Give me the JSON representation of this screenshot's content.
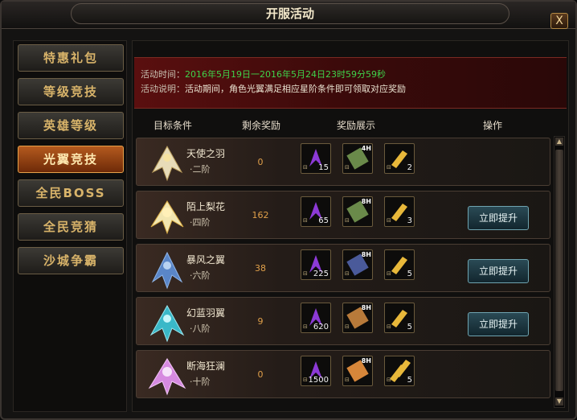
{
  "window": {
    "title": "开服活动",
    "close_label": "X"
  },
  "sidebar": {
    "items": [
      {
        "label": "特惠礼包",
        "active": false
      },
      {
        "label": "等级竞技",
        "active": false
      },
      {
        "label": "英雄等级",
        "active": false
      },
      {
        "label": "光翼竞技",
        "active": true
      },
      {
        "label": "全民BOSS",
        "active": false
      },
      {
        "label": "全民竞猜",
        "active": false
      },
      {
        "label": "沙城争霸",
        "active": false
      }
    ]
  },
  "banner": {
    "time_label": "活动时间：",
    "time_value": "2016年5月19日一2016年5月24日23时59分59秒",
    "desc_label": "活动说明：",
    "desc_value": "活动期间，角色光翼满足相应星阶条件即可领取对应奖励"
  },
  "headers": {
    "goal": "目标条件",
    "remaining": "剩余奖励",
    "rewards": "奖励展示",
    "action": "操作"
  },
  "rows": [
    {
      "name": "天使之羽",
      "tier": "·二阶",
      "remaining": "0",
      "items": [
        {
          "count": "15",
          "tag": ""
        },
        {
          "count": "",
          "tag": "4H"
        },
        {
          "count": "2",
          "tag": ""
        }
      ],
      "button": ""
    },
    {
      "name": "陌上梨花",
      "tier": "·四阶",
      "remaining": "162",
      "items": [
        {
          "count": "65",
          "tag": ""
        },
        {
          "count": "",
          "tag": "8H"
        },
        {
          "count": "3",
          "tag": ""
        }
      ],
      "button": "立即提升"
    },
    {
      "name": "暴风之翼",
      "tier": "·六阶",
      "remaining": "38",
      "items": [
        {
          "count": "225",
          "tag": ""
        },
        {
          "count": "",
          "tag": "8H"
        },
        {
          "count": "5",
          "tag": ""
        }
      ],
      "button": "立即提升"
    },
    {
      "name": "幻蓝羽翼",
      "tier": "·八阶",
      "remaining": "9",
      "items": [
        {
          "count": "620",
          "tag": ""
        },
        {
          "count": "",
          "tag": "8H"
        },
        {
          "count": "5",
          "tag": ""
        }
      ],
      "button": "立即提升"
    },
    {
      "name": "断海狂澜",
      "tier": "·十阶",
      "remaining": "0",
      "items": [
        {
          "count": "1500",
          "tag": ""
        },
        {
          "count": "",
          "tag": "8H"
        },
        {
          "count": "5",
          "tag": ""
        }
      ],
      "button": ""
    }
  ],
  "icons": [
    "close-icon",
    "purple-wing-icon",
    "scroll-icon",
    "gold-bar-icon",
    "scroll-up-icon",
    "scroll-down-icon"
  ],
  "colors": {
    "active_tab": "#b45a1e",
    "time_green": "#3fd24a",
    "remaining_orange": "#e0a04a",
    "banner_red": "#5a0f0f"
  }
}
